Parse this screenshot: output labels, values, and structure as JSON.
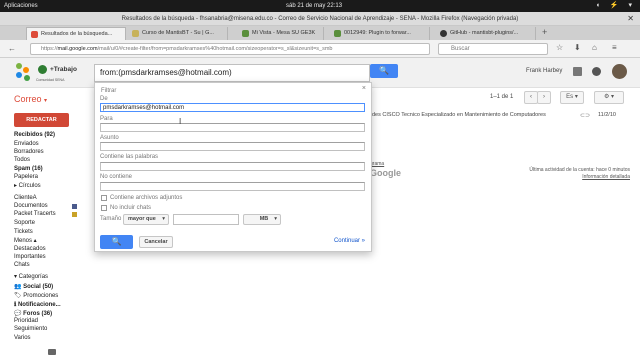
{
  "os": {
    "apps_label": "Aplicaciones",
    "clock": "sáb 21 de may   22:13",
    "tray": "◖ ⚡ ▾"
  },
  "window": {
    "title": "Resultados de la búsqueda - fhsanabria@misena.edu.co - Correo de Servicio Nacional de Aprendizaje - SENA - Mozilla Firefox (Navegación privada)",
    "close": "✕"
  },
  "tabs": [
    {
      "label": "Resultados de la búsqueda...",
      "color": "#dd4b39"
    },
    {
      "label": "Curso de MantisBT - Su | G...",
      "color": "#c7b25a"
    },
    {
      "label": "Mi Vista - Mesa SU GE3K",
      "color": "#5a8f3c"
    },
    {
      "label": "0012949: Plugin to forwar...",
      "color": "#5a8f3c"
    },
    {
      "label": "GitHub - mantisbt-plugins/...",
      "color": "#333333"
    }
  ],
  "nav": {
    "back": "←",
    "url_host": "mail.google.com",
    "url_prefix": "https://",
    "url_rest": "/mail/u/0/#create-filter/from=pmsdarkramses%40hotmail.com/sizeoperator=s_sl&sizeunit=s_smb",
    "search_placeholder": "Buscar"
  },
  "gmail": {
    "logo_text": "+Trabajo",
    "logo_sub": "Comunidad SENA",
    "query": "from:(pmsdarkramses@hotmail.com)",
    "user": "Frank Harbey",
    "search_icon": "🔍"
  },
  "toolbar": {
    "correo": "Correo",
    "correo_caret": "▾",
    "pager": "1–1 de 1",
    "prev": "‹",
    "next": "›",
    "lang": "Es ▾",
    "settings": "⚙ ▾"
  },
  "sidebar": {
    "compose": "REDACTAR",
    "items": [
      {
        "label": "Recibidos (92)",
        "bold": true
      },
      {
        "label": "Enviados",
        "bold": false
      },
      {
        "label": "Borradores",
        "bold": false
      },
      {
        "label": "Todos",
        "bold": false
      },
      {
        "label": "Spam (16)",
        "bold": true
      },
      {
        "label": "Papelera",
        "bold": false
      },
      {
        "label": "▸ Círculos",
        "bold": false
      },
      {
        "label": "ClienteA",
        "bold": false
      },
      {
        "label": "Documentos",
        "bold": false,
        "color": "#4a5a8c"
      },
      {
        "label": "Packet Tracerts",
        "bold": false,
        "color": "#c9a227"
      },
      {
        "label": "Soporte",
        "bold": false
      },
      {
        "label": "Tickets",
        "bold": false
      },
      {
        "label": "Menos ▴",
        "bold": false
      },
      {
        "label": "Destacados",
        "bold": false
      },
      {
        "label": "Importantes",
        "bold": false
      },
      {
        "label": "Chats",
        "bold": false
      },
      {
        "label": "▾ Categorías",
        "bold": false
      },
      {
        "label": "👥 Social (50)",
        "bold": true
      },
      {
        "label": "🏷 Promociones",
        "bold": false
      },
      {
        "label": "ℹ Notificacione...",
        "bold": true
      },
      {
        "label": "💬 Foros (36)",
        "bold": true
      },
      {
        "label": "Prioridad",
        "bold": false
      },
      {
        "label": "Seguimiento",
        "bold": false
      },
      {
        "label": "Varios",
        "bold": false
      }
    ]
  },
  "content": {
    "row_text": "des CISCO Tecnico Especializado en Mantenimiento de Computadores",
    "row_date": "11/2/10",
    "programs": "grama",
    "google": "Google",
    "activity_line": "Última actividad de la cuenta: hace 0 minutos",
    "activity_link": "Información detallada"
  },
  "filter": {
    "title": "Filtrar",
    "close": "×",
    "from_label": "De",
    "from_value": "pmsdarkramses@hotmail.com",
    "to_label": "Para",
    "subject_label": "Asunto",
    "has_words_label": "Contiene las palabras",
    "no_words_label": "No contiene",
    "has_attachment_label": "Contiene archivos adjuntos",
    "no_chats_label": "No incluir chats",
    "size_label": "Tamaño",
    "size_operator": "mayor que",
    "size_unit": "MB",
    "search_button": "🔍",
    "cancel_button": "Cancelar",
    "continue_link": "Continuar »"
  }
}
